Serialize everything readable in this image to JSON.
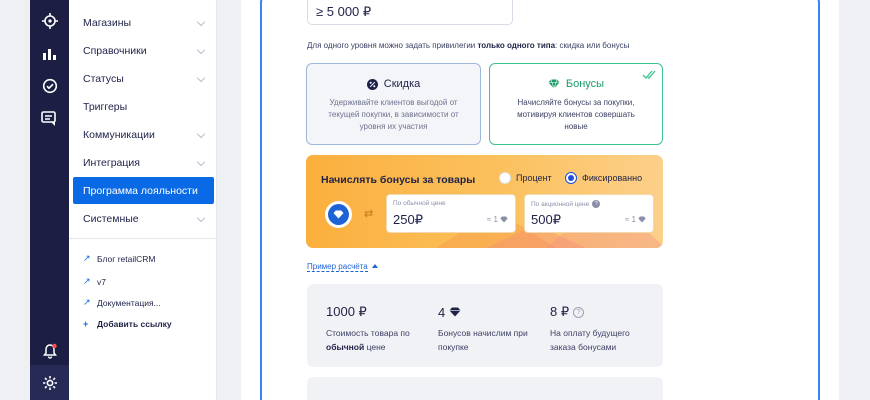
{
  "sidebar": {
    "items": [
      {
        "label": "Магазины",
        "has_chevron": true
      },
      {
        "label": "Справочники",
        "has_chevron": true
      },
      {
        "label": "Статусы",
        "has_chevron": true
      },
      {
        "label": "Триггеры",
        "has_chevron": false
      },
      {
        "label": "Коммуникации",
        "has_chevron": true
      },
      {
        "label": "Интеграция",
        "has_chevron": true
      },
      {
        "label": "Программа лояльности",
        "has_chevron": false,
        "active": true
      },
      {
        "label": "Системные",
        "has_chevron": true
      }
    ],
    "links": [
      {
        "label": "Блог retailCRM"
      },
      {
        "label": "v7"
      },
      {
        "label": "Документация..."
      }
    ],
    "add_link": "Добавить ссылку"
  },
  "level": {
    "amount": "≥ 5 000 ₽"
  },
  "privileges": {
    "hint_prefix": "Для одного уровня можно задать привилегии ",
    "hint_bold": "только одного типа",
    "hint_suffix": ": скидка или бонусы",
    "discount": {
      "title": "Скидка",
      "desc": "Удерживайте клиентов выгодой от текущей покупки, в зависимости от уровня их участия"
    },
    "bonus": {
      "title": "Бонусы",
      "desc": "Начисляйте бонусы за покупки, мотивируя клиентов совершать новые",
      "selected": true
    }
  },
  "accrual": {
    "title": "Начислять бонусы за товары",
    "option_percent": "Процент",
    "option_fixed": "Фиксированно",
    "selected": "fixed",
    "regular_label": "По обычной цене",
    "regular_value": "250₽",
    "regular_rate": "≈ 1",
    "promo_label": "По акционной цене",
    "promo_value": "500₽",
    "promo_rate": "≈ 1"
  },
  "example": {
    "link": "Пример расчёта",
    "stats": [
      {
        "value": "1000 ₽",
        "text_before": "Стоимость товара по ",
        "text_bold": "обычной",
        "text_after": " цене"
      },
      {
        "value": "4",
        "text_before": "Бонусов начислим при покупке",
        "text_bold": "",
        "text_after": ""
      },
      {
        "value": "8 ₽",
        "text_before": "На оплату будущего заказа бонусами",
        "text_bold": "",
        "text_after": ""
      }
    ]
  },
  "colors": {
    "accent": "#0a6ae6",
    "bonus_green": "#1a9b66",
    "rail": "#1c1f43",
    "orange": "#fbaf3d"
  }
}
